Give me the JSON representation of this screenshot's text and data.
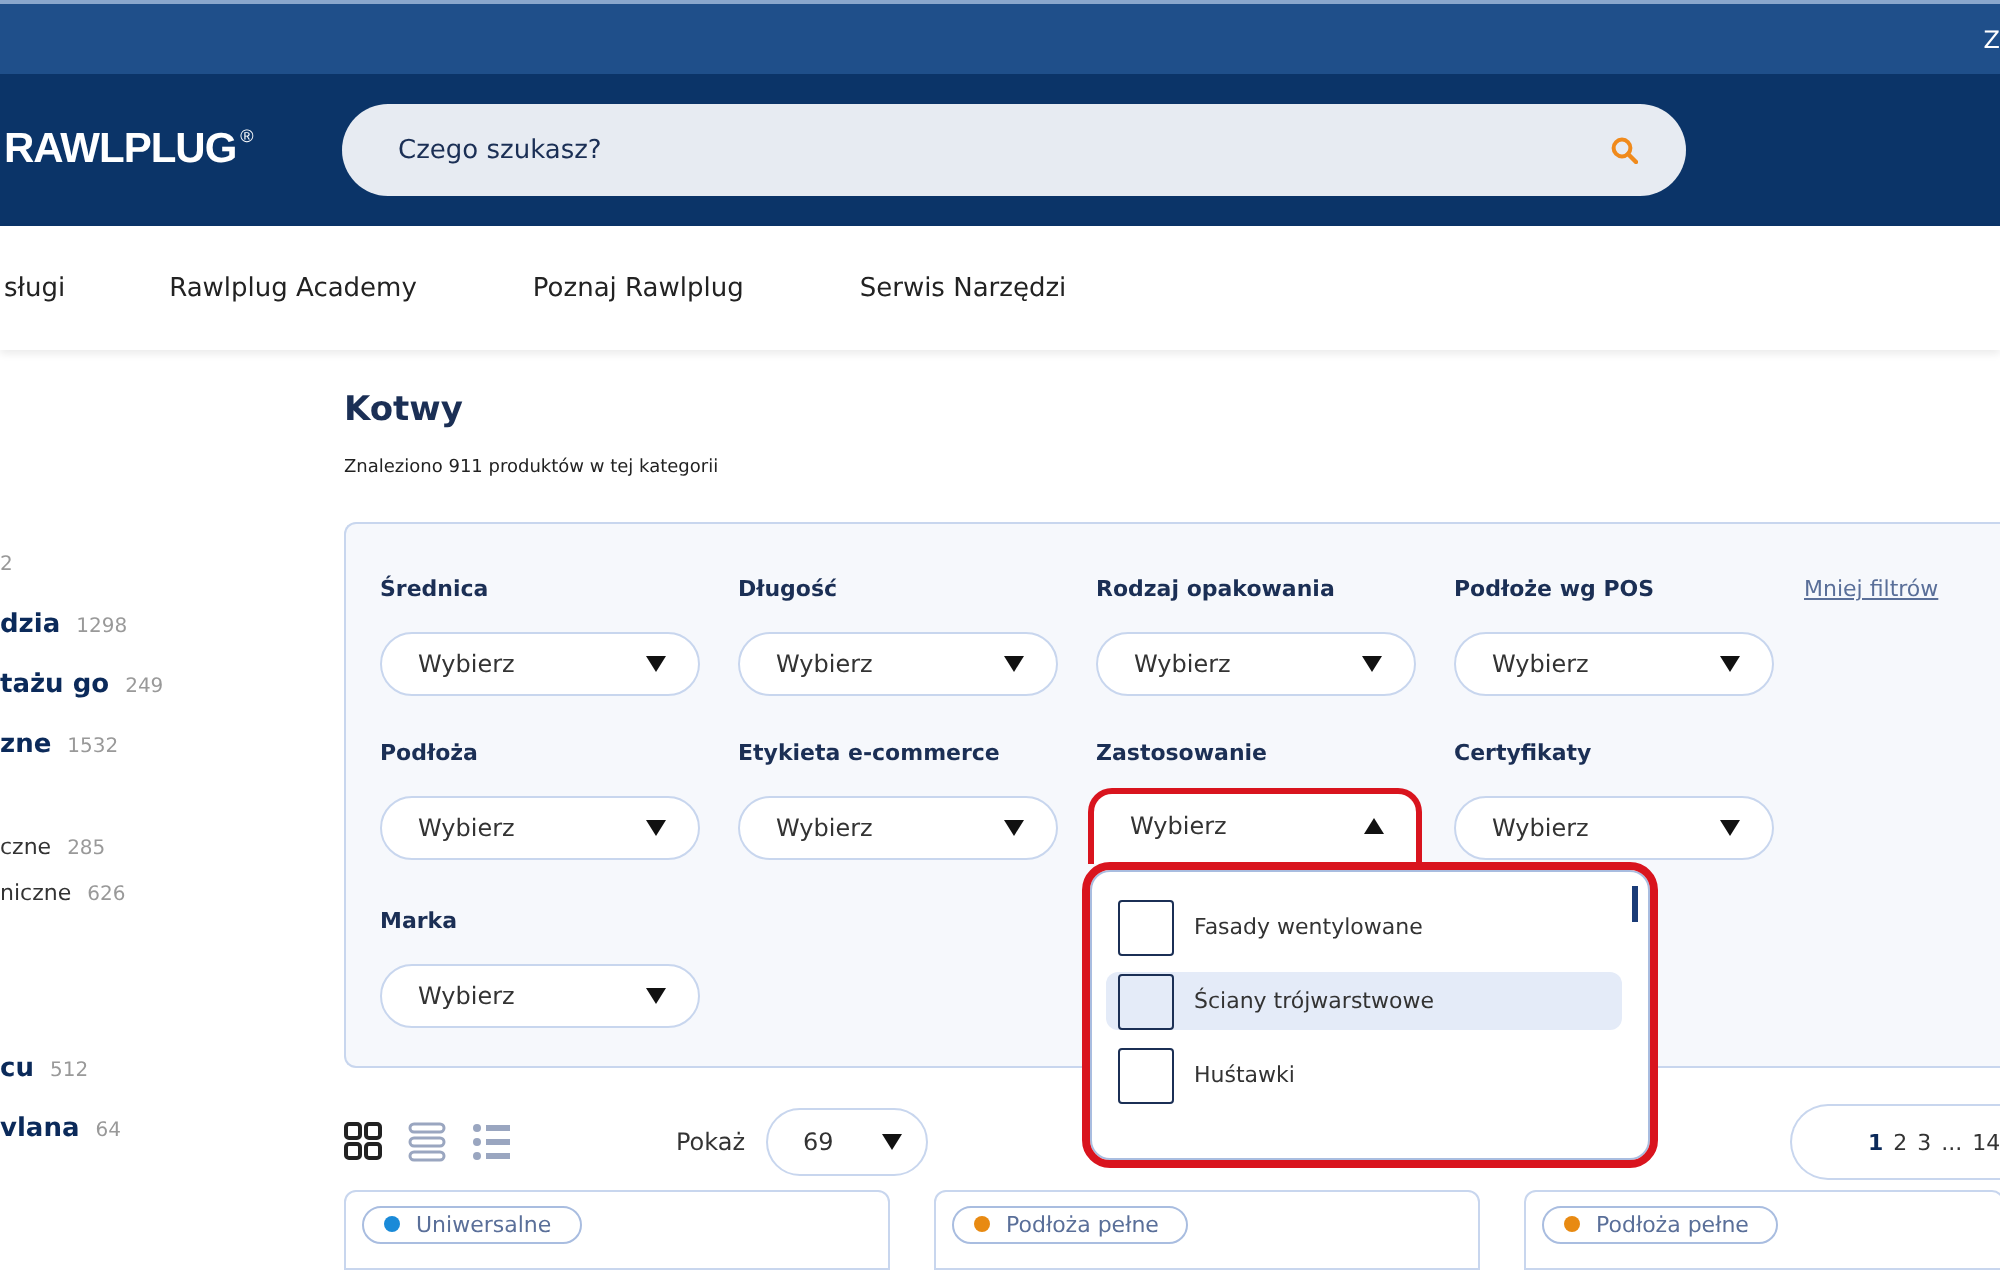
{
  "top_bar": {
    "text": "Z"
  },
  "header": {
    "logo": "RAWLPLUG",
    "logo_mark": "®",
    "search": {
      "placeholder": "Czego szukasz?"
    }
  },
  "nav": {
    "items": [
      {
        "label": "sługi"
      },
      {
        "label": "Rawlplug Academy"
      },
      {
        "label": "Poznaj Rawlplug"
      },
      {
        "label": "Serwis Narzędzi"
      }
    ]
  },
  "sidebar": {
    "groups": [
      {
        "items": [
          {
            "kind": "count",
            "count": "2"
          }
        ]
      },
      {
        "items": [
          {
            "kind": "category",
            "label": "dzia",
            "count": "1298"
          },
          {
            "kind": "category",
            "label": "tażu go",
            "count": "249"
          },
          {
            "kind": "category",
            "label": "zne",
            "count": "1532"
          }
        ]
      },
      {
        "items": [
          {
            "kind": "subcategory",
            "label": "czne",
            "count": "285"
          },
          {
            "kind": "subcategory",
            "label": "niczne",
            "count": "626"
          }
        ]
      },
      {
        "items": [
          {
            "kind": "category",
            "label": "cu",
            "count": "512"
          },
          {
            "kind": "category",
            "label": "vlana",
            "count": "64"
          }
        ]
      }
    ]
  },
  "page": {
    "title": "Kotwy",
    "summary": "Znaleziono 911 produktów w tej kategorii"
  },
  "filters": {
    "less_link": "Mniej filtrów",
    "items": [
      {
        "label": "Średnica",
        "value": "Wybierz",
        "expanded": false
      },
      {
        "label": "Długość",
        "value": "Wybierz",
        "expanded": false
      },
      {
        "label": "Rodzaj opakowania",
        "value": "Wybierz",
        "expanded": false
      },
      {
        "label": "Podłoże wg POS",
        "value": "Wybierz",
        "expanded": false
      },
      {
        "label": "Podłoża",
        "value": "Wybierz",
        "expanded": false
      },
      {
        "label": "Etykieta e-commerce",
        "value": "Wybierz",
        "expanded": false
      },
      {
        "label": "Zastosowanie",
        "value": "Wybierz",
        "expanded": true,
        "options": [
          {
            "label": "Fasady wentylowane",
            "checked": false,
            "highlighted": false
          },
          {
            "label": "Ściany trójwarstwowe",
            "checked": false,
            "highlighted": true
          },
          {
            "label": "Huśtawki",
            "checked": false,
            "highlighted": false
          }
        ]
      },
      {
        "label": "Certyfikaty",
        "value": "Wybierz",
        "expanded": false
      },
      {
        "label": "Marka",
        "value": "Wybierz",
        "expanded": false
      }
    ]
  },
  "toolbar": {
    "views": [
      {
        "kind": "grid",
        "selected": true
      },
      {
        "kind": "rows",
        "selected": false
      },
      {
        "kind": "list",
        "selected": false
      }
    ],
    "show_label": "Pokaż",
    "show_value": "69",
    "pages": [
      {
        "label": "1",
        "selected": true
      },
      {
        "label": "2",
        "selected": false
      },
      {
        "label": "3",
        "selected": false
      },
      {
        "label": "...",
        "selected": false
      },
      {
        "label": "14",
        "selected": false
      }
    ]
  },
  "cards": [
    {
      "tag": "Uniwersalne",
      "color": "#1a8ad8"
    },
    {
      "tag": "Podłoża pełne",
      "color": "#e88a12"
    },
    {
      "tag": "Podłoża pełne",
      "color": "#e88a12"
    }
  ]
}
